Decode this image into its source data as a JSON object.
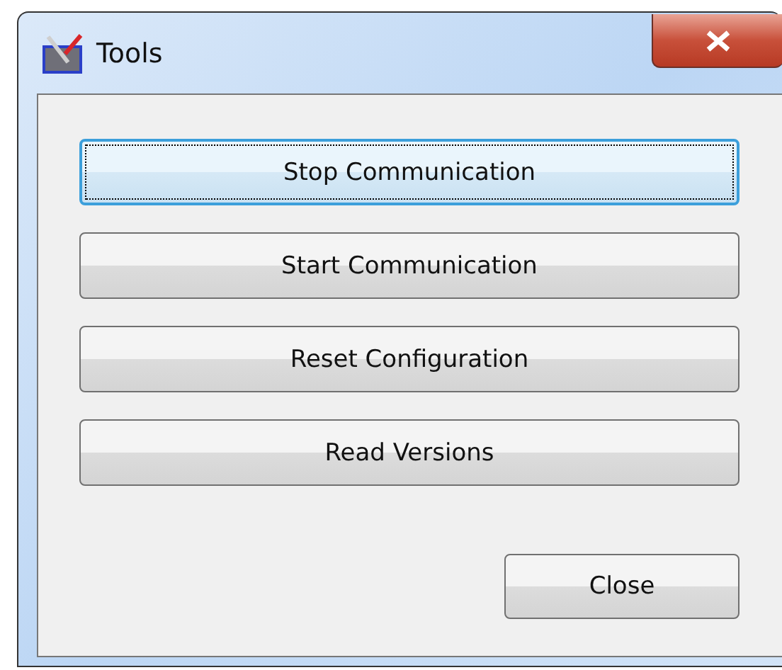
{
  "window": {
    "title": "Tools"
  },
  "buttons": [
    {
      "label": "Stop Communication",
      "focused": true
    },
    {
      "label": "Start Communication",
      "focused": false
    },
    {
      "label": "Reset Configuration",
      "focused": false
    },
    {
      "label": "Read Versions",
      "focused": false
    }
  ],
  "footer_button": {
    "label": "Close",
    "focused": false
  }
}
